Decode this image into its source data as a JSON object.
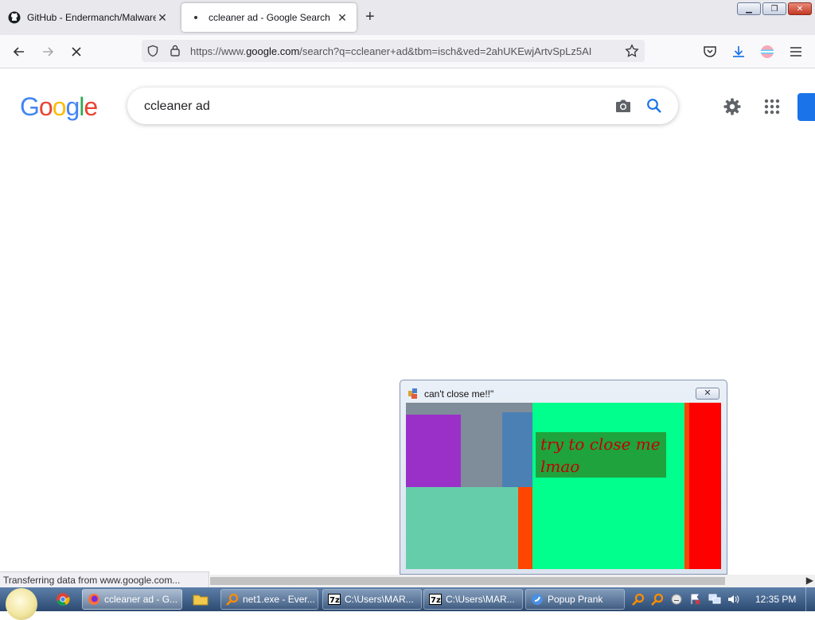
{
  "browser": {
    "tabs": [
      {
        "title": "GitHub - Endermanch/Malware",
        "active": false
      },
      {
        "title": "ccleaner ad - Google Search",
        "active": true
      }
    ],
    "url": {
      "prefix": "https://www.",
      "host": "google.com",
      "rest": "/search?q=ccleaner+ad&tbm=isch&ved=2ahUKEwjArtvSpLz5AI"
    },
    "status_text": "Transferring data from www.google.com..."
  },
  "google": {
    "logo_letters": [
      {
        "ch": "G",
        "color": "#4285F4"
      },
      {
        "ch": "o",
        "color": "#EA4335"
      },
      {
        "ch": "o",
        "color": "#FBBC05"
      },
      {
        "ch": "g",
        "color": "#4285F4"
      },
      {
        "ch": "l",
        "color": "#34A853"
      },
      {
        "ch": "e",
        "color": "#EA4335"
      }
    ],
    "query": "ccleaner ad"
  },
  "popup": {
    "title": "can't close me!!\"",
    "message": "try to close me lmao",
    "close_glyph": "✕"
  },
  "taskbar": {
    "buttons": [
      {
        "label": "ccleaner ad - G...",
        "icon": "firefox-icon",
        "active": true
      },
      {
        "label": "net1.exe - Ever...",
        "icon": "everything-search-icon",
        "active": false
      },
      {
        "label": "C:\\Users\\MAR...",
        "icon": "7zip-icon",
        "active": false
      },
      {
        "label": "C:\\Users\\MAR...",
        "icon": "7zip-icon",
        "active": false
      },
      {
        "label": "Popup Prank",
        "icon": "app-icon",
        "active": false
      }
    ],
    "clock": "12:35 PM"
  },
  "colors": {
    "google_blue": "#1a73e8",
    "popup_green": "#00ff8c",
    "popup_red": "#ff0000"
  }
}
